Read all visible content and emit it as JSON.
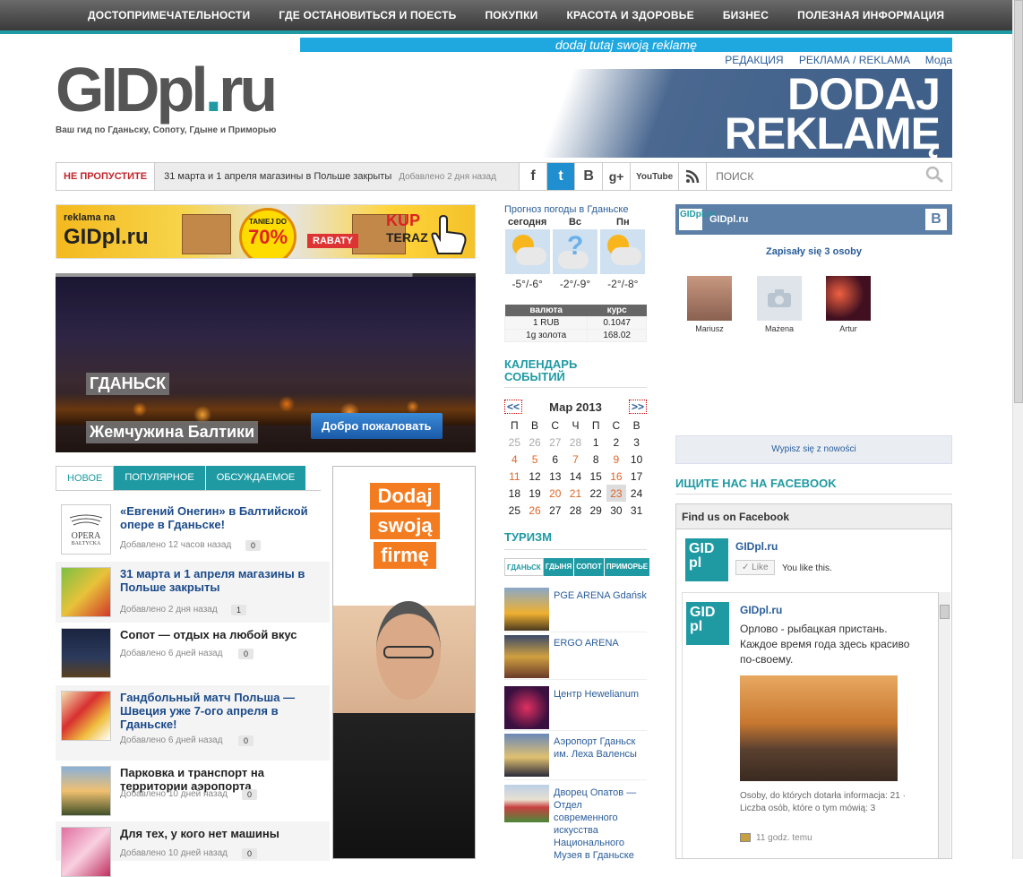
{
  "nav": [
    "ДОСТОПРИМЕЧАТЕЛЬНОСТИ",
    "ГДЕ ОСТАНОВИТЬСЯ И ПОЕСТЬ",
    "ПОКУПКИ",
    "КРАСОТА И ЗДОРОВЬЕ",
    "БИЗНЕС",
    "ПОЛЕЗНАЯ ИНФОРМАЦИЯ"
  ],
  "ad_strip": "dodaj tutaj swoją reklamę",
  "top_links": [
    "РЕДАКЦИЯ",
    "РЕКЛАМА / REKLAMA",
    "Мода"
  ],
  "logo": {
    "main": "GIDpl",
    "dot": ".",
    "tld": "ru",
    "tagline": "Ваш гид по Гданьску, Сопоту, Гдыне и Приморью"
  },
  "banner": {
    "line1": "DODAJ",
    "line2": "REKLAMĘ"
  },
  "ticker": {
    "label": "НЕ ПРОПУСТИТЕ",
    "headline": "31 марта и 1 апреля магазины в Польше закрыты",
    "added": "Добавлено 2 дня назад"
  },
  "social": [
    "f",
    "t",
    "B",
    "g+",
    "YouTube",
    "rss"
  ],
  "search": {
    "placeholder": "ПОИСК"
  },
  "promo": {
    "line1": "reklama na",
    "line2": "GIDpl.ru",
    "taniej": "TANIEJ DO",
    "percent": "70%",
    "rabaty": "RABATY",
    "kup": "KUP",
    "teraz": "TERAZ"
  },
  "slider": {
    "city": "ГДАНЬСК",
    "subtitle": "Жемчужина Балтики",
    "button": "Добро пожаловать"
  },
  "tabs": [
    "НОВОЕ",
    "ПОПУЛЯРНОЕ",
    "ОБСУЖДАЕМОЕ"
  ],
  "news": [
    {
      "title": "«Евгений Онегин» в Балтийской опере в Гданьске!",
      "meta": "Добавлено 12 часов назад",
      "count": "0",
      "thumb_text": "OPERA",
      "thumb_sub": "BAŁTYCKA"
    },
    {
      "title": "31 марта и 1 апреля магазины в Польше закрыты",
      "meta": "Добавлено 2 дня назад",
      "count": "1"
    },
    {
      "title": "Сопот — отдых на любой вкус",
      "meta": "Добавлено 6 дней назад",
      "count": "0"
    },
    {
      "title": "Гандбольный матч Польша — Швеция уже 7-ого апреля в Гданьске!",
      "meta": "Добавлено 6 дней назад",
      "count": "0"
    },
    {
      "title": "Парковка и транспорт на территории аэропорта",
      "meta": "Добавлено 10 дней назад",
      "count": "0"
    },
    {
      "title": "Для тех, у кого нет машины",
      "meta": "Добавлено 10 дней назад",
      "count": "0"
    }
  ],
  "tall_ad": [
    "Dodaj",
    "swoją",
    "firmę"
  ],
  "weather": {
    "title": "Прогноз погоды в Гданьске",
    "days": [
      {
        "name": "сегодня",
        "temp": "-5°/-6°"
      },
      {
        "name": "Вс",
        "temp": "-2°/-9°"
      },
      {
        "name": "Пн",
        "temp": "-2°/-8°"
      }
    ]
  },
  "rates": {
    "headers": [
      "валюта",
      "курс"
    ],
    "rows": [
      [
        "1 RUB",
        "0.1047"
      ],
      [
        "1g золота",
        "168.02"
      ]
    ]
  },
  "calendar": {
    "title_l1": "КАЛЕНДАРЬ",
    "title_l2": "СОБЫТИЙ",
    "prev": "<<",
    "next": ">>",
    "month": "Мар 2013",
    "weekdays": [
      "П",
      "В",
      "С",
      "Ч",
      "П",
      "С",
      "В"
    ],
    "weeks": [
      [
        "25",
        "26",
        "27",
        "28",
        "1",
        "2",
        "3"
      ],
      [
        "4",
        "5",
        "6",
        "7",
        "8",
        "9",
        "10"
      ],
      [
        "11",
        "12",
        "13",
        "14",
        "15",
        "16",
        "17"
      ],
      [
        "18",
        "19",
        "20",
        "21",
        "22",
        "23",
        "24"
      ],
      [
        "25",
        "26",
        "27",
        "28",
        "29",
        "30",
        "31"
      ]
    ]
  },
  "tourism": {
    "title": "ТУРИЗМ",
    "tabs": [
      "ГДАНЬСК",
      "ГДЫНЯ",
      "СОПОТ",
      "ПРИМОРЬЕ"
    ],
    "items": [
      "PGE ARENA Gdańsk",
      "ERGO ARENA",
      "Центр Hewelianum",
      "Аэропорт Гданьск им. Леха Валенсы",
      "Дворец Опатов — Отдел современного искусства Национального Музея в Гданьске"
    ]
  },
  "vk": {
    "name": "GIDpl.ru",
    "logo": "GIDpl.ru",
    "b": "B",
    "subs": "Zapisały się 3 osoby",
    "members": [
      "Mariusz",
      "Mażena",
      "Artur"
    ],
    "subscribe": "Wypisz się z nowości"
  },
  "facebook": {
    "section": "ИЩИТЕ НАС НА FACEBOOK",
    "head": "Find us on Facebook",
    "page": "GIDpl.ru",
    "like": "Like",
    "you_like": "You like this.",
    "post_text": "Орлово - рыбацкая пристань. Каждое время года здесь красиво по-своему.",
    "stats": "Osoby, do których dotarła informacja: 21 · Liczba osób, które o tym mówią: 3",
    "time": "11 godz. temu"
  }
}
